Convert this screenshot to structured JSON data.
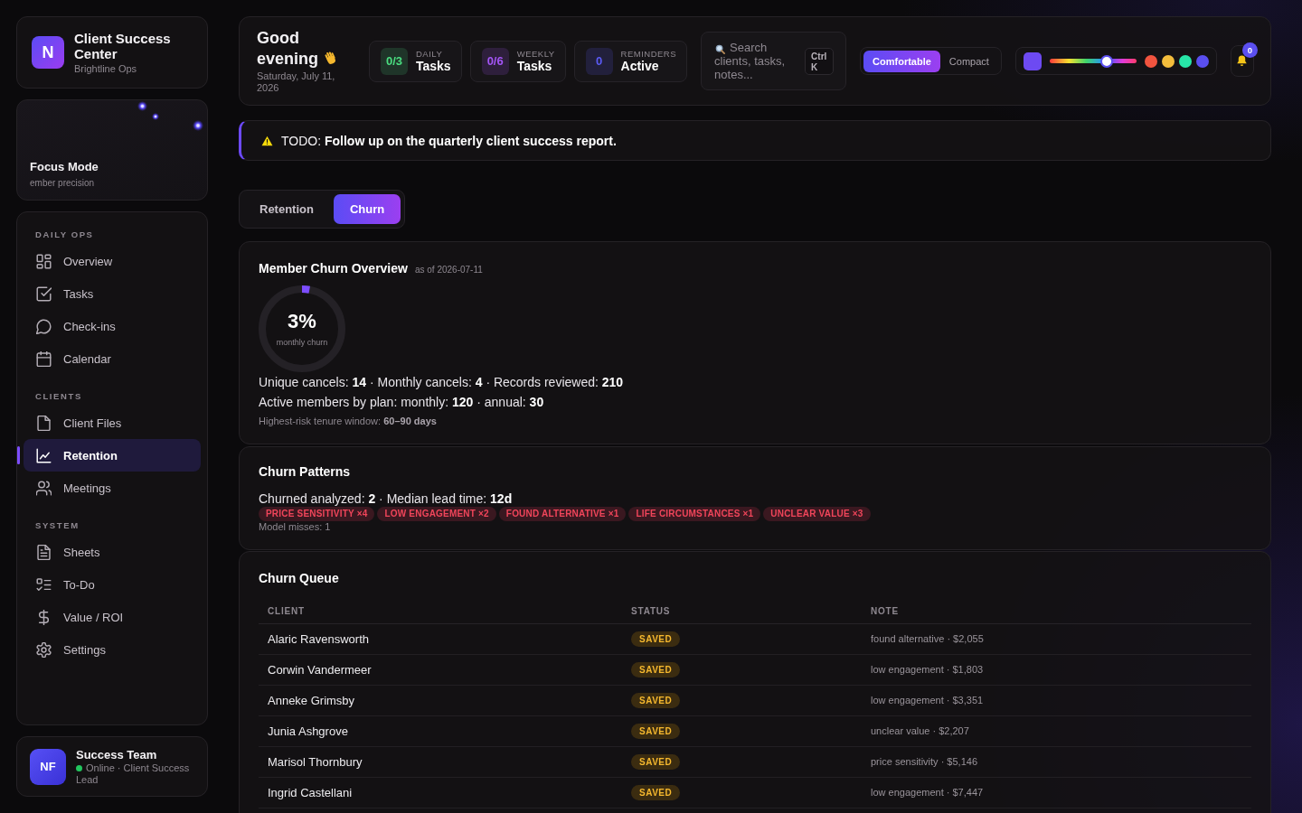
{
  "brand": {
    "logo": "N",
    "title": "Client Success Center",
    "subtitle": "Brightline Ops"
  },
  "focus_card": {
    "title": "Focus Mode",
    "subtitle": "ember precision"
  },
  "sidebar": {
    "sections": [
      {
        "heading": "DAILY OPS",
        "items": [
          {
            "label": "Overview",
            "selected": false
          },
          {
            "label": "Tasks",
            "selected": false
          },
          {
            "label": "Check-ins",
            "selected": false
          },
          {
            "label": "Calendar",
            "selected": false
          }
        ]
      },
      {
        "heading": "CLIENTS",
        "items": [
          {
            "label": "Client Files",
            "selected": false
          },
          {
            "label": "Retention",
            "selected": true
          },
          {
            "label": "Meetings",
            "selected": false
          }
        ]
      },
      {
        "heading": "SYSTEM",
        "items": [
          {
            "label": "Sheets",
            "selected": false
          },
          {
            "label": "To-Do",
            "selected": false
          },
          {
            "label": "Value / ROI",
            "selected": false
          },
          {
            "label": "Settings",
            "selected": false
          }
        ]
      }
    ]
  },
  "profile": {
    "avatar": "NF",
    "name": "Success Team",
    "online": true,
    "status": "Online · Client Success Lead"
  },
  "topbar": {
    "greeting": "Good evening",
    "date": "Saturday, July 11, 2026",
    "stats": [
      {
        "value": "0/3",
        "label": "DAILY",
        "title": "Tasks",
        "color": "#4ade80"
      },
      {
        "value": "0/6",
        "label": "WEEKLY",
        "title": "Tasks",
        "color": "#a455f7"
      },
      {
        "value": "0",
        "label": "REMINDERS",
        "title": "Active",
        "color": "#5b5bf6"
      }
    ],
    "search": {
      "placeholder": "Search clients, tasks, notes...",
      "shortcut": "Ctrl K"
    },
    "density": [
      {
        "label": "Comfortable",
        "selected": true
      },
      {
        "label": "Compact",
        "selected": false
      }
    ],
    "theme": {
      "swatch": {
        "color": "#6d4af2"
      },
      "hue": {
        "level": 0.66
      },
      "presets": [
        {
          "color": "#f1543f"
        },
        {
          "color": "#f3bd3c"
        },
        {
          "color": "#27e6a8"
        },
        {
          "color": "#5a4ff0"
        }
      ]
    },
    "notifications": {
      "count": "0"
    }
  },
  "todo": {
    "text": "TODO: **Follow up on the quarterly client success report.**"
  },
  "tabs": [
    {
      "label": "Retention",
      "selected": false
    },
    {
      "label": "Churn",
      "selected": true
    }
  ],
  "overview": {
    "title": "Member Churn Overview",
    "as_of": "as of 2026-07-11",
    "ring": {
      "value": "3%",
      "caption": "monthly churn",
      "level": 0.03
    },
    "lines": [
      "Unique cancels: **14** · Monthly cancels: **4** · Records reviewed: **210**",
      "Active members by plan: monthly: **120** · annual: **30**"
    ],
    "note": "Highest-risk tenure window: **60–90 days**"
  },
  "patterns": {
    "title": "Churn Patterns",
    "summary": "Churned analyzed: **2** · Median lead time: **12d**",
    "tags": [
      "PRICE SENSITIVITY ×4",
      "LOW ENGAGEMENT ×2",
      "FOUND ALTERNATIVE ×1",
      "LIFE CIRCUMSTANCES ×1",
      "UNCLEAR VALUE ×3"
    ],
    "note": "Model misses: 1"
  },
  "queue": {
    "title": "Churn Queue",
    "columns": [
      "CLIENT",
      "STATUS",
      "NOTE"
    ],
    "rows": [
      {
        "client": "Alaric Ravensworth",
        "status": "SAVED",
        "note": "found alternative · $2,055"
      },
      {
        "client": "Corwin Vandermeer",
        "status": "SAVED",
        "note": "low engagement · $1,803"
      },
      {
        "client": "Anneke Grimsby",
        "status": "SAVED",
        "note": "low engagement · $3,351"
      },
      {
        "client": "Junia Ashgrove",
        "status": "SAVED",
        "note": "unclear value · $2,207"
      },
      {
        "client": "Marisol Thornbury",
        "status": "SAVED",
        "note": "price sensitivity · $5,146"
      },
      {
        "client": "Ingrid Castellani",
        "status": "SAVED",
        "note": "low engagement · $7,447"
      }
    ]
  }
}
